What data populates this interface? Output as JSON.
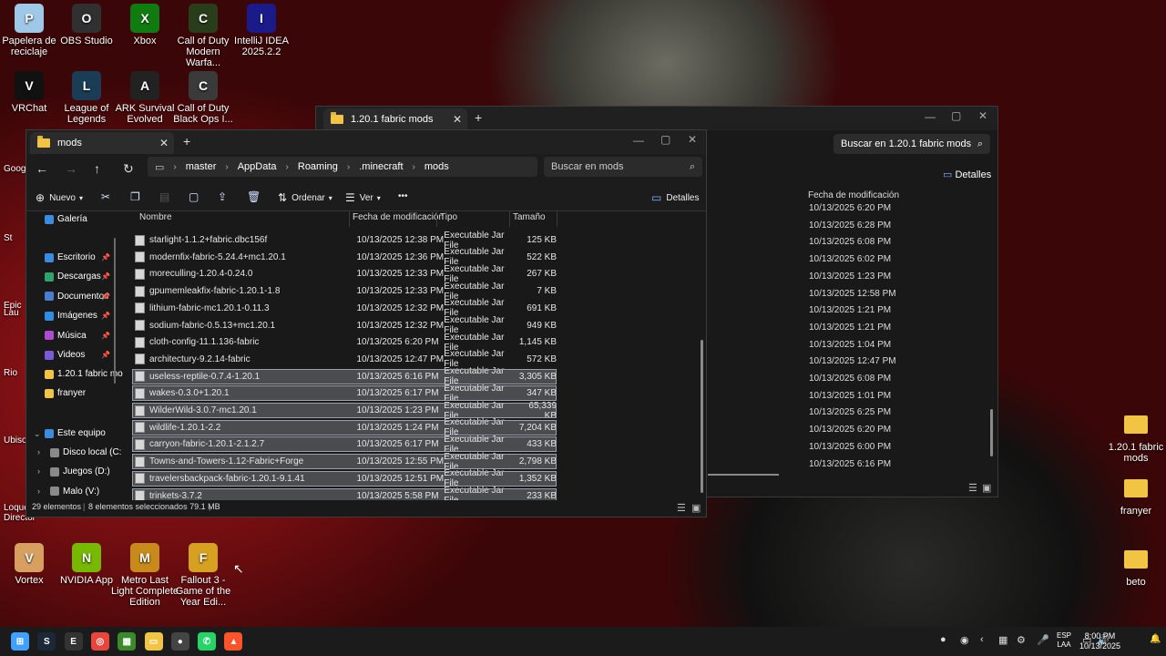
{
  "desktop": {
    "icons_top": [
      {
        "label": "Papelera de reciclaje",
        "icon": "recycle-bin-icon",
        "color": "#9ec7e8"
      },
      {
        "label": "OBS Studio",
        "icon": "obs-icon",
        "color": "#303030"
      },
      {
        "label": "Xbox",
        "icon": "xbox-icon",
        "color": "#107c10"
      },
      {
        "label": "Call of Duty Modern Warfa...",
        "icon": "cod-icon",
        "color": "#2a3d1a"
      },
      {
        "label": "IntelliJ IDEA 2025.2.2",
        "icon": "intellij-icon",
        "color": "#1a1a8a"
      }
    ],
    "icons_row2": [
      {
        "label": "VRChat",
        "icon": "vrchat-icon",
        "color": "#111"
      },
      {
        "label": "League of Legends",
        "icon": "lol-icon",
        "color": "#1b3c55"
      },
      {
        "label": "ARK Survival Evolved",
        "icon": "ark-icon",
        "color": "#222"
      },
      {
        "label": "Call of Duty Black Ops I...",
        "icon": "cod-bo-icon",
        "color": "#3a3a3a"
      }
    ],
    "icons_bottom": [
      {
        "label": "Vortex",
        "icon": "vortex-icon",
        "color": "#d8a060"
      },
      {
        "label": "NVIDIA App",
        "icon": "nvidia-icon",
        "color": "#76b900"
      },
      {
        "label": "Metro Last Light Complete Edition",
        "icon": "metro-icon",
        "color": "#c88a1a"
      },
      {
        "label": "Fallout 3 - Game of the Year Edi...",
        "icon": "fallout-icon",
        "color": "#d6a020"
      }
    ],
    "icons_right": [
      {
        "label": "1.20.1 fabric mods",
        "icon": "folder-icon"
      },
      {
        "label": "franyer",
        "icon": "folder-icon"
      },
      {
        "label": "beto",
        "icon": "folder-icon"
      }
    ],
    "partial_left": [
      "Googl",
      "St",
      "Epic",
      "Lau",
      "Rio",
      "Ubiso",
      "Loque",
      "Director"
    ]
  },
  "back_window": {
    "tab": "1.20.1 fabric mods",
    "search_placeholder": "Buscar en 1.20.1 fabric mods",
    "details_label": "Detalles",
    "col_date": "Fecha de modificación",
    "dates": [
      "10/13/2025 6:20 PM",
      "10/13/2025 6:28 PM",
      "10/13/2025 6:08 PM",
      "10/13/2025 6:02 PM",
      "10/13/2025 1:23 PM",
      "10/13/2025 12:58 PM",
      "10/13/2025 1:21 PM",
      "10/13/2025 1:21 PM",
      "10/13/2025 1:04 PM",
      "10/13/2025 12:47 PM",
      "10/13/2025 6:08 PM",
      "10/13/2025 1:01 PM",
      "10/13/2025 6:25 PM",
      "10/13/2025 6:20 PM",
      "10/13/2025 6:00 PM",
      "10/13/2025 6:16 PM"
    ]
  },
  "window": {
    "tab": "mods",
    "breadcrumbs": [
      "master",
      "AppData",
      "Roaming",
      ".minecraft",
      "mods"
    ],
    "search_placeholder": "Buscar en mods",
    "toolbar": {
      "new": "Nuevo",
      "sort": "Ordenar",
      "view": "Ver",
      "details": "Detalles",
      "more": "•••"
    },
    "sidebar": {
      "galeria": "Galería",
      "pinned": [
        "Escritorio",
        "Descargas",
        "Documentos",
        "Imágenes",
        "Música",
        "Videos"
      ],
      "folders": [
        "1.20.1 fabric mo",
        "franyer"
      ],
      "este_equipo": "Este equipo",
      "drives": [
        "Disco local (C:",
        "Juegos (D:)",
        "Malo (V:)"
      ]
    },
    "columns": {
      "name": "Nombre",
      "date": "Fecha de modificación",
      "type": "Tipo",
      "size": "Tamaño"
    },
    "files": [
      {
        "name": "starlight-1.1.2+fabric.dbc156f",
        "date": "10/13/2025 12:38 PM",
        "type": "Executable Jar File",
        "size": "125 KB",
        "selected": false
      },
      {
        "name": "modernfix-fabric-5.24.4+mc1.20.1",
        "date": "10/13/2025 12:36 PM",
        "type": "Executable Jar File",
        "size": "522 KB",
        "selected": false
      },
      {
        "name": "moreculling-1.20.4-0.24.0",
        "date": "10/13/2025 12:33 PM",
        "type": "Executable Jar File",
        "size": "267 KB",
        "selected": false
      },
      {
        "name": "gpumemleakfix-fabric-1.20.1-1.8",
        "date": "10/13/2025 12:33 PM",
        "type": "Executable Jar File",
        "size": "7 KB",
        "selected": false
      },
      {
        "name": "lithium-fabric-mc1.20.1-0.11.3",
        "date": "10/13/2025 12:32 PM",
        "type": "Executable Jar File",
        "size": "691 KB",
        "selected": false
      },
      {
        "name": "sodium-fabric-0.5.13+mc1.20.1",
        "date": "10/13/2025 12:32 PM",
        "type": "Executable Jar File",
        "size": "949 KB",
        "selected": false
      },
      {
        "name": "cloth-config-11.1.136-fabric",
        "date": "10/13/2025 6:20 PM",
        "type": "Executable Jar File",
        "size": "1,145 KB",
        "selected": false
      },
      {
        "name": "architectury-9.2.14-fabric",
        "date": "10/13/2025 12:47 PM",
        "type": "Executable Jar File",
        "size": "572 KB",
        "selected": false
      },
      {
        "name": "useless-reptile-0.7.4-1.20.1",
        "date": "10/13/2025 6:16 PM",
        "type": "Executable Jar File",
        "size": "3,305 KB",
        "selected": true
      },
      {
        "name": "wakes-0.3.0+1.20.1",
        "date": "10/13/2025 6:17 PM",
        "type": "Executable Jar File",
        "size": "347 KB",
        "selected": true
      },
      {
        "name": "WilderWild-3.0.7-mc1.20.1",
        "date": "10/13/2025 1:23 PM",
        "type": "Executable Jar File",
        "size": "65,339 KB",
        "selected": true
      },
      {
        "name": "wildlife-1.20.1-2.2",
        "date": "10/13/2025 1:24 PM",
        "type": "Executable Jar File",
        "size": "7,204 KB",
        "selected": true
      },
      {
        "name": "carryon-fabric-1.20.1-2.1.2.7",
        "date": "10/13/2025 6:17 PM",
        "type": "Executable Jar File",
        "size": "433 KB",
        "selected": true
      },
      {
        "name": "Towns-and-Towers-1.12-Fabric+Forge",
        "date": "10/13/2025 12:55 PM",
        "type": "Executable Jar File",
        "size": "2,798 KB",
        "selected": true
      },
      {
        "name": "travelersbackpack-fabric-1.20.1-9.1.41",
        "date": "10/13/2025 12:51 PM",
        "type": "Executable Jar File",
        "size": "1,352 KB",
        "selected": true
      },
      {
        "name": "trinkets-3.7.2",
        "date": "10/13/2025 5:58 PM",
        "type": "Executable Jar File",
        "size": "233 KB",
        "selected": true
      }
    ],
    "status": {
      "count": "29 elementos",
      "selected": "8 elementos seleccionados  79.1 MB"
    }
  },
  "taskbar": {
    "icons": [
      "start-icon",
      "steam-icon",
      "epic-icon",
      "chrome-icon",
      "minecraft-icon",
      "explorer-icon",
      "github-icon",
      "whatsapp-icon",
      "brave-icon"
    ],
    "lang": "ESP",
    "lang2": "LAA",
    "time": "8:00 PM",
    "date": "10/13/2025"
  }
}
